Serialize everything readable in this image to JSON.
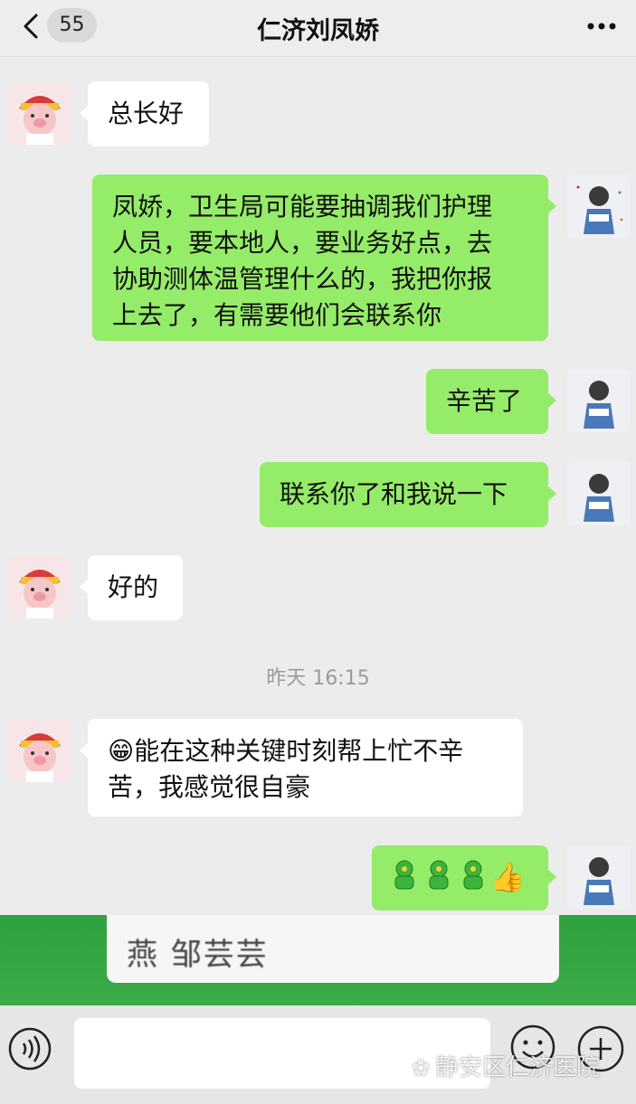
{
  "header": {
    "back_icon": "chevron-left-icon",
    "unread_count": "55",
    "title": "仁济刘凤娇",
    "more_icon": "more-dots-icon"
  },
  "messages": [
    {
      "side": "left",
      "text": "总长好"
    },
    {
      "side": "right",
      "lines": [
        "凤娇，卫生局可能要抽调我们护理",
        "人员，要本地人，要业务好点，去",
        "协助测体温管理什么的，我把你报",
        "上去了，有需要他们会联系你"
      ]
    },
    {
      "side": "right",
      "text": "辛苦了"
    },
    {
      "side": "right",
      "text": "联系你了和我说一下"
    },
    {
      "side": "left",
      "text": "好的"
    },
    {
      "side": "left",
      "emoji": "😁",
      "lines": [
        "能在这种关键时刻帮上忙不辛",
        "苦，我感觉很自豪"
      ]
    },
    {
      "side": "right",
      "emoji_row": "👍"
    }
  ],
  "timestamp": "昨天 16:15",
  "overlay": {
    "text": "燕 邹芸芸"
  },
  "input": {
    "voice_icon": "voice-icon",
    "emoji_icon": "emoji-icon",
    "plus_icon": "plus-icon"
  },
  "watermark": "静安区仁济医院",
  "colors": {
    "outgoing": "#95ec69",
    "incoming": "#ffffff",
    "background": "#ececec"
  }
}
